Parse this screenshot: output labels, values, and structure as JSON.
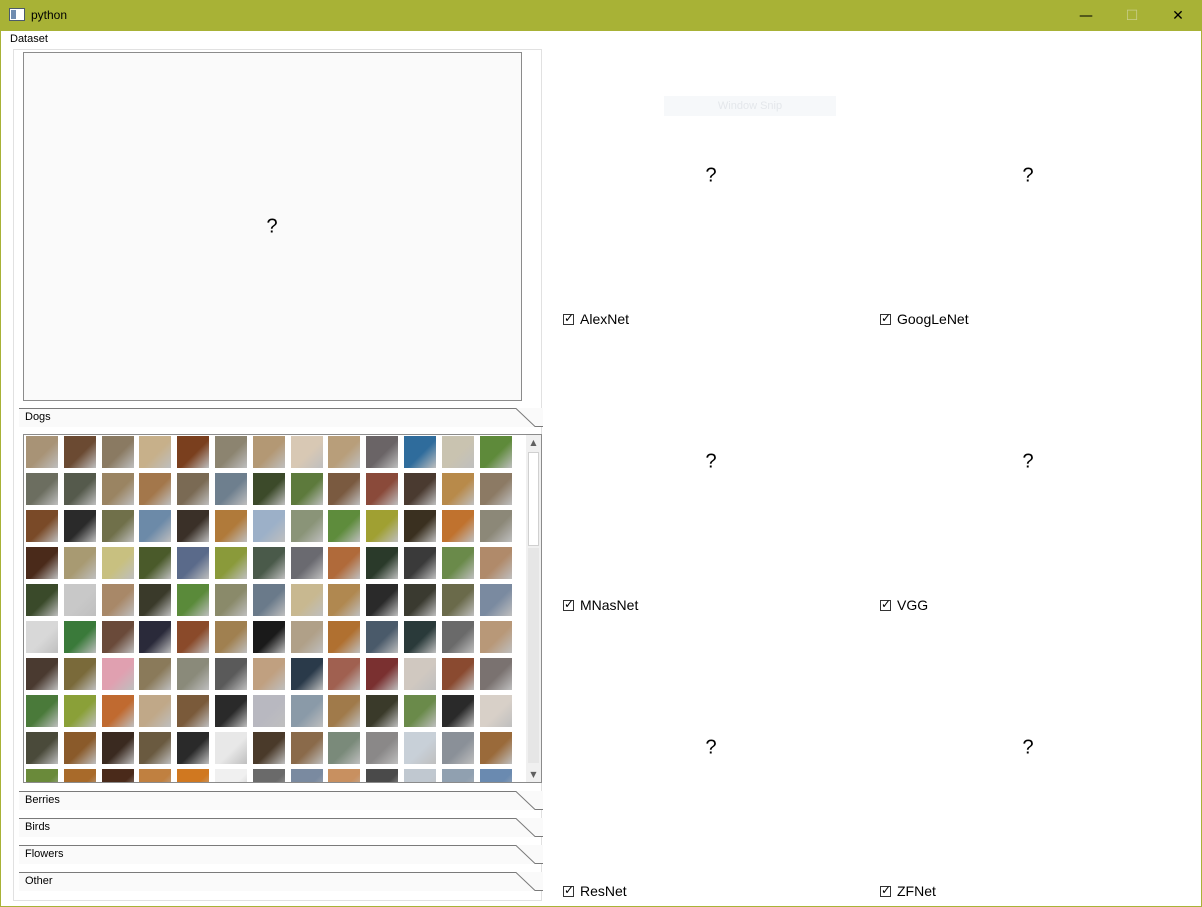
{
  "window": {
    "title": "python",
    "min_glyph": "—",
    "max_glyph": "☐",
    "close_glyph": "✕",
    "icon": "app-window-icon"
  },
  "dataset": {
    "label": "Dataset",
    "preview_placeholder": "?",
    "categories": [
      {
        "label": "Dogs",
        "expanded": true
      },
      {
        "label": "Berries",
        "expanded": false
      },
      {
        "label": "Birds",
        "expanded": false
      },
      {
        "label": "Flowers",
        "expanded": false
      },
      {
        "label": "Other",
        "expanded": false
      }
    ],
    "thumbnail_colors": [
      "#a89376",
      "#6b4a32",
      "#8a7a62",
      "#c7b08a",
      "#7a3f1e",
      "#8c8470",
      "#b39874",
      "#d8c8b4",
      "#b89e7a",
      "#6a6466",
      "#2f6c9c",
      "#c9c3b0",
      "#5e8a3a",
      "#6c6e60",
      "#555a4c",
      "#9a8462",
      "#a3774b",
      "#7a6a54",
      "#6e7f8e",
      "#3c4a2a",
      "#5d7a3c",
      "#7a5a40",
      "#8a4a3a",
      "#4a3a30",
      "#b88a4a",
      "#8c7a64",
      "#7a4a28",
      "#2a2a2a",
      "#70704a",
      "#6c8aa8",
      "#3a3028",
      "#b07a3a",
      "#9cb0c8",
      "#8a9478",
      "#5e8c3c",
      "#a0a032",
      "#3a3020",
      "#c0722e",
      "#8c8878",
      "#4a2a1a",
      "#a89a72",
      "#c8c080",
      "#4a5a2a",
      "#5a6a8a",
      "#8a9a3a",
      "#4a5a4a",
      "#6a6a70",
      "#b06a3a",
      "#2a3a2a",
      "#3a3a3a",
      "#6a8a4a",
      "#b08a6a",
      "#3a4a2a",
      "#c8c8c8",
      "#a88868",
      "#3a3a2a",
      "#5a8a3a",
      "#8a8a6a",
      "#6a7a8a",
      "#c8b890",
      "#b08850",
      "#2a2a2a",
      "#3a3a30",
      "#6a6a4a",
      "#7a8aa0",
      "#d8d8d8",
      "#3a7a3a",
      "#6a4a3a",
      "#2a2a3a",
      "#8a4a2a",
      "#a08050",
      "#1a1a1a",
      "#b0a088",
      "#b07030",
      "#4a5a6a",
      "#2a3a3a",
      "#6a6a6a",
      "#b89878",
      "#4a3a30",
      "#7a6a3a",
      "#e0a0b0",
      "#8a7a5a",
      "#8a8a7a",
      "#5a5a5a",
      "#c0a080",
      "#2a3a4a",
      "#a06050",
      "#7a3030",
      "#d0c8c0",
      "#8a4a30",
      "#7a7270",
      "#4a7a3a",
      "#8aa038",
      "#c06a30",
      "#c0a888",
      "#7a5a3a",
      "#2a2a2a",
      "#b8b8c0",
      "#8a9aa8",
      "#a07a4a",
      "#3a3a2a",
      "#6a8a4a",
      "#2a2a2a",
      "#d8d0c8",
      "#4a4a3a",
      "#8a5a2a",
      "#3a2a20",
      "#6a5a40",
      "#2a2a2a",
      "#e8e8e8",
      "#4a3a2a",
      "#8a6a4a",
      "#7a8a7a",
      "#8a8888",
      "#c8d0d8",
      "#8a9098",
      "#9a6a3a",
      "#6a8a3a",
      "#a86a2a",
      "#4a2a1a",
      "#c08040",
      "#d07820",
      "#f0f0f0",
      "#6a6a6a",
      "#7a8aa0",
      "#c89060",
      "#4a4a4a",
      "#c0c8d0",
      "#90a0b0",
      "#6a8ab0"
    ]
  },
  "results": [
    {
      "placeholder": "?",
      "model": "AlexNet",
      "checked": true
    },
    {
      "placeholder": "?",
      "model": "GoogLeNet",
      "checked": true
    },
    {
      "placeholder": "?",
      "model": "MNasNet",
      "checked": true
    },
    {
      "placeholder": "?",
      "model": "VGG",
      "checked": true
    },
    {
      "placeholder": "?",
      "model": "ResNet",
      "checked": true
    },
    {
      "placeholder": "?",
      "model": "ZFNet",
      "checked": true
    }
  ],
  "faint_overlay": "Window Snip",
  "scrollbar": {
    "up": "▲",
    "down": "▼"
  }
}
